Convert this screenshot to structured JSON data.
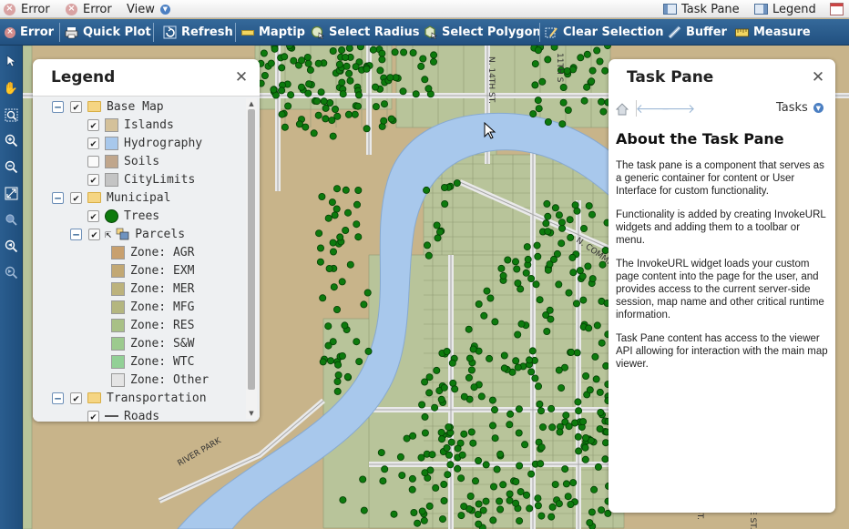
{
  "menubar": {
    "items": [
      {
        "label": "Error",
        "icon": "error-icon"
      },
      {
        "label": "Error",
        "icon": "error-icon"
      },
      {
        "label": "View",
        "icon": "chevron-down-icon"
      }
    ],
    "right_items": [
      {
        "label": "Task Pane",
        "icon": "task-pane-icon"
      },
      {
        "label": "Legend",
        "icon": "legend-icon"
      }
    ]
  },
  "toolbar": {
    "buttons": [
      {
        "label": "Error",
        "icon": "error-icon"
      },
      {
        "label": "Quick Plot",
        "icon": "print-icon"
      },
      {
        "label": "Refresh",
        "icon": "refresh-icon"
      },
      {
        "label": "Maptip",
        "icon": "maptip-icon"
      },
      {
        "label": "Select Radius",
        "icon": "select-radius-icon"
      },
      {
        "label": "Select Polygon",
        "icon": "select-polygon-icon"
      },
      {
        "label": "Clear Selection",
        "icon": "clear-selection-icon"
      },
      {
        "label": "Buffer",
        "icon": "buffer-icon"
      },
      {
        "label": "Measure",
        "icon": "measure-icon"
      }
    ]
  },
  "navbar": {
    "tools": [
      "select-arrow-icon",
      "pan-icon",
      "zoom-rectangle-icon",
      "zoom-in-icon",
      "zoom-out-icon",
      "zoom-extents-icon",
      "zoom-selection-icon",
      "previous-view-icon",
      "next-view-icon"
    ]
  },
  "map": {
    "labels": [
      "N. 14TH ST.",
      "N. COMMER",
      "RIVER PARK",
      "11TH S",
      "ST.",
      "E ST."
    ]
  },
  "legend": {
    "title": "Legend",
    "layers": [
      {
        "label": "Base Map",
        "type": "group",
        "checked": true,
        "expanded": true
      },
      {
        "label": "Islands",
        "type": "layer",
        "checked": true,
        "color": "#d4c19a"
      },
      {
        "label": "Hydrography",
        "type": "layer",
        "checked": true,
        "color": "#a8c8ec"
      },
      {
        "label": "Soils",
        "type": "layer",
        "checked": false,
        "color": "#c0a68c"
      },
      {
        "label": "CityLimits",
        "type": "layer",
        "checked": true,
        "color": "#c4c4c4"
      },
      {
        "label": "Municipal",
        "type": "group",
        "checked": true,
        "expanded": true
      },
      {
        "label": "Trees",
        "type": "layer",
        "checked": true,
        "color": "#0d7a0d"
      },
      {
        "label": "Parcels",
        "type": "group",
        "checked": true,
        "expanded": true
      },
      {
        "label": "Zone: AGR",
        "type": "theme",
        "color": "#c8a06e"
      },
      {
        "label": "Zone: EXM",
        "type": "theme",
        "color": "#c2a874"
      },
      {
        "label": "Zone: MER",
        "type": "theme",
        "color": "#bcb27c"
      },
      {
        "label": "Zone: MFG",
        "type": "theme",
        "color": "#b4b680"
      },
      {
        "label": "Zone: RES",
        "type": "theme",
        "color": "#a8c086"
      },
      {
        "label": "Zone: S&W",
        "type": "theme",
        "color": "#9cca8e"
      },
      {
        "label": "Zone: WTC",
        "type": "theme",
        "color": "#92d096"
      },
      {
        "label": "Zone: Other",
        "type": "theme",
        "color": "#e4e4e4"
      },
      {
        "label": "Transportation",
        "type": "group",
        "checked": true,
        "expanded": true
      },
      {
        "label": "Roads",
        "type": "layer",
        "checked": true,
        "color": "#555555"
      }
    ]
  },
  "taskpane": {
    "title": "Task Pane",
    "tasks_label": "Tasks",
    "heading": "About the Task Pane",
    "paragraphs": [
      "The task pane is a component that serves as a generic container for content or User Interface for custom functionality.",
      "Functionality is added by creating InvokeURL widgets and adding them to a toolbar or menu.",
      "The InvokeURL widget loads your custom page content into the page for the user, and provides access to the current server-side session, map name and other critical runtime information.",
      "Task Pane content has access to the viewer API allowing for interaction with the main map viewer."
    ]
  },
  "colors": {
    "toolbar_bg": "#2a5d8f",
    "water": "#a8c8ec",
    "land": "#c8b48a",
    "parcel_green": "#b8c49a",
    "tree": "#0d7a0d"
  }
}
